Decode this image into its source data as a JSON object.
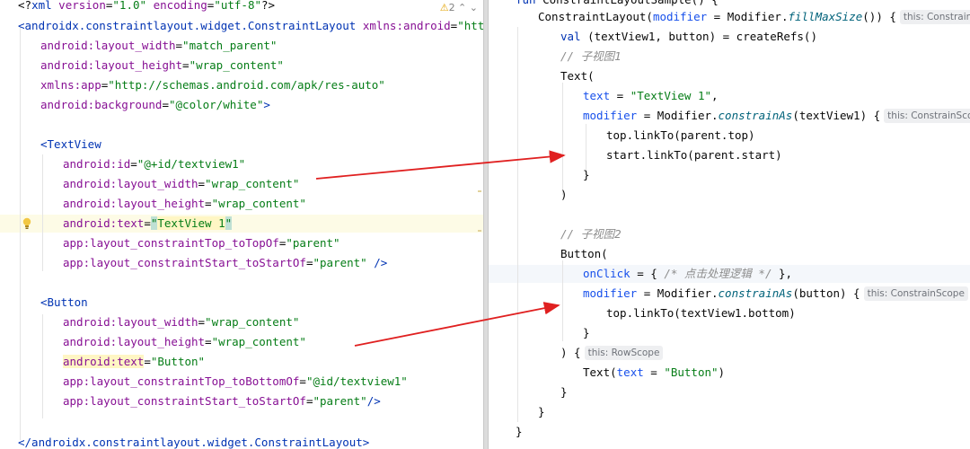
{
  "left_editor": {
    "warning_count": "2",
    "lines": [
      [
        [
          "t-plain",
          "<?"
        ],
        [
          "t-tag",
          "xml "
        ],
        [
          "t-attr",
          "version"
        ],
        [
          "t-plain",
          "="
        ],
        [
          "t-str",
          "\"1.0\""
        ],
        [
          "t-plain",
          " "
        ],
        [
          "t-attr",
          "encoding"
        ],
        [
          "t-plain",
          "="
        ],
        [
          "t-str",
          "\"utf-8\""
        ],
        [
          "t-plain",
          "?>"
        ]
      ],
      [
        [
          "t-bracket",
          "<androidx.constraintlayout.widget.ConstraintLayout "
        ],
        [
          "t-attr",
          "xmlns:android"
        ],
        [
          "t-plain",
          "="
        ],
        [
          "t-str",
          "\"http://schemas.android.com/apk/res/android\""
        ]
      ],
      [
        [
          "t-attr",
          "android:layout_width"
        ],
        [
          "t-plain",
          "="
        ],
        [
          "t-str",
          "\"match_parent\""
        ]
      ],
      [
        [
          "t-attr",
          "android:layout_height"
        ],
        [
          "t-plain",
          "="
        ],
        [
          "t-str",
          "\"wrap_content\""
        ]
      ],
      [
        [
          "t-attr",
          "xmlns:app"
        ],
        [
          "t-plain",
          "="
        ],
        [
          "t-str",
          "\"http://schemas.android.com/apk/res-auto\""
        ]
      ],
      [
        [
          "t-attr",
          "android:background"
        ],
        [
          "t-plain",
          "="
        ],
        [
          "t-str",
          "\"@color/white\""
        ],
        [
          "t-bracket",
          ">"
        ]
      ],
      [],
      [
        [
          "t-bracket",
          "<TextView"
        ]
      ],
      [
        [
          "t-attr",
          "android:id"
        ],
        [
          "t-plain",
          "="
        ],
        [
          "t-str",
          "\"@+id/textview1\""
        ]
      ],
      [
        [
          "t-attr",
          "android:layout_width"
        ],
        [
          "t-plain",
          "="
        ],
        [
          "t-str",
          "\"wrap_content\""
        ]
      ],
      [
        [
          "t-attr",
          "android:layout_height"
        ],
        [
          "t-plain",
          "="
        ],
        [
          "t-str",
          "\"wrap_content\""
        ]
      ],
      [
        [
          "t-attr",
          "android:text"
        ],
        [
          "t-plain",
          "="
        ],
        [
          "t-str sel-caret",
          "\""
        ],
        [
          "t-str hl-word",
          "TextView 1"
        ],
        [
          "t-str sel-caret",
          "\""
        ]
      ],
      [
        [
          "t-attr",
          "app:layout_constraintTop_toTopOf"
        ],
        [
          "t-plain",
          "="
        ],
        [
          "t-str",
          "\"parent\""
        ]
      ],
      [
        [
          "t-attr",
          "app:layout_constraintStart_toStartOf"
        ],
        [
          "t-plain",
          "="
        ],
        [
          "t-str",
          "\"parent\""
        ],
        [
          "t-bracket",
          " />"
        ]
      ],
      [],
      [
        [
          "t-bracket",
          "<Button"
        ]
      ],
      [
        [
          "t-attr",
          "android:layout_width"
        ],
        [
          "t-plain",
          "="
        ],
        [
          "t-str",
          "\"wrap_content\""
        ]
      ],
      [
        [
          "t-attr",
          "android:layout_height"
        ],
        [
          "t-plain",
          "="
        ],
        [
          "t-str",
          "\"wrap_content\""
        ]
      ],
      [
        [
          "t-attr hl-word",
          "android:text"
        ],
        [
          "t-plain",
          "="
        ],
        [
          "t-str",
          "\"Button\""
        ]
      ],
      [
        [
          "t-attr",
          "app:layout_constraintTop_toBottomOf"
        ],
        [
          "t-plain",
          "="
        ],
        [
          "t-str",
          "\"@id/textview1\""
        ]
      ],
      [
        [
          "t-attr",
          "app:layout_constraintStart_toStartOf"
        ],
        [
          "t-plain",
          "="
        ],
        [
          "t-str",
          "\"parent\""
        ],
        [
          "t-bracket",
          "/>"
        ]
      ],
      [],
      [
        [
          "t-bracket",
          "</androidx.constraintlayout.widget.ConstraintLayout>"
        ]
      ]
    ]
  },
  "right_editor": {
    "lines": [
      [
        [
          "t-key",
          "fun "
        ],
        [
          "t-plain",
          "ConstraintLayoutSample() {"
        ]
      ],
      [
        [
          "t-plain",
          "ConstraintLayout("
        ],
        [
          "t-param",
          "modifier"
        ],
        [
          "t-plain",
          " = Modifier."
        ],
        [
          "t-italic",
          "fillMaxSize"
        ],
        [
          "t-plain",
          "()) {"
        ],
        [
          "hint",
          "this: ConstraintLayoutScope"
        ]
      ],
      [
        [
          "t-key",
          "val "
        ],
        [
          "t-plain",
          "(textView1, button) = createRefs()"
        ]
      ],
      [
        [
          "t-comment",
          "// 子视图1"
        ]
      ],
      [
        [
          "t-plain",
          "Text("
        ]
      ],
      [
        [
          "t-param",
          "text"
        ],
        [
          "t-plain",
          " = "
        ],
        [
          "t-str",
          "\"TextView 1\""
        ],
        [
          "t-plain",
          ","
        ]
      ],
      [
        [
          "t-param",
          "modifier"
        ],
        [
          "t-plain",
          " = Modifier."
        ],
        [
          "t-italic",
          "constrainAs"
        ],
        [
          "t-plain",
          "(textView1) {"
        ],
        [
          "hint",
          "this: ConstrainScope"
        ]
      ],
      [
        [
          "t-plain",
          "top.linkTo(parent.top)"
        ]
      ],
      [
        [
          "t-plain",
          "start.linkTo(parent.start)"
        ]
      ],
      [
        [
          "t-plain",
          "}"
        ]
      ],
      [
        [
          "t-plain",
          ")"
        ]
      ],
      [],
      [
        [
          "t-comment",
          "// 子视图2"
        ]
      ],
      [
        [
          "t-plain",
          "Button("
        ]
      ],
      [
        [
          "t-param",
          "onClick"
        ],
        [
          "t-plain",
          " = { "
        ],
        [
          "t-comment",
          "/* 点击处理逻辑 */"
        ],
        [
          "t-plain",
          " },"
        ]
      ],
      [
        [
          "t-param",
          "modifier"
        ],
        [
          "t-plain",
          " = Modifier."
        ],
        [
          "t-italic",
          "constrainAs"
        ],
        [
          "t-plain",
          "(button) {"
        ],
        [
          "hint",
          "this: ConstrainScope"
        ]
      ],
      [
        [
          "t-plain",
          "top.linkTo(textView1.bottom)"
        ]
      ],
      [
        [
          "t-plain",
          "}"
        ]
      ],
      [
        [
          "t-plain",
          ") {"
        ],
        [
          "hint",
          "this: RowScope"
        ]
      ],
      [
        [
          "t-plain",
          "Text("
        ],
        [
          "t-param",
          "text"
        ],
        [
          "t-plain",
          " = "
        ],
        [
          "t-str",
          "\"Button\""
        ],
        [
          "t-plain",
          ")"
        ]
      ],
      [
        [
          "t-plain",
          "}"
        ]
      ],
      [
        [
          "t-plain",
          "}"
        ]
      ],
      [
        [
          "t-plain",
          "}"
        ]
      ]
    ]
  },
  "colors": {
    "arrow": "#e02020",
    "selection": "#fff6c4"
  }
}
